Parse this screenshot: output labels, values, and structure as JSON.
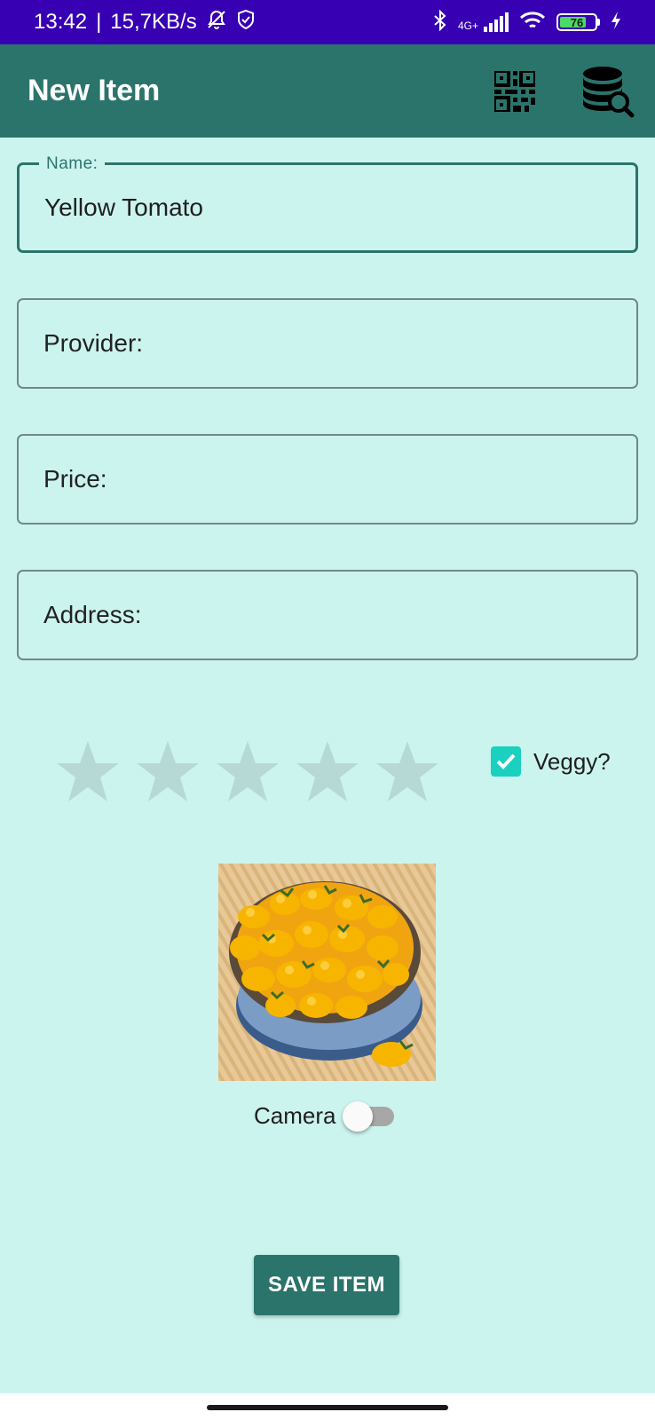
{
  "status_bar": {
    "time": "13:42",
    "separator": "|",
    "net_speed": "15,7KB/s",
    "network_type": "4G+",
    "battery_level": "76",
    "battery_fraction": 0.76,
    "icons": [
      "bell-off-icon",
      "shield-icon",
      "bluetooth-icon",
      "signal-icon",
      "wifi-icon",
      "battery-icon",
      "charging-icon"
    ]
  },
  "app_bar": {
    "title": "New Item",
    "background": "#2b746b",
    "actions": [
      "qr-code-icon",
      "database-search-icon"
    ]
  },
  "form": {
    "name": {
      "label": "Name:",
      "value": "Yellow Tomato"
    },
    "provider": {
      "placeholder": "Provider:"
    },
    "price": {
      "placeholder": "Price:"
    },
    "address": {
      "placeholder": "Address:"
    }
  },
  "rating": {
    "max": 5,
    "value": 0
  },
  "veggy": {
    "label": "Veggy?",
    "checked": true
  },
  "camera": {
    "label": "Camera",
    "enabled": false
  },
  "save": {
    "label": "SAVE ITEM"
  },
  "colors": {
    "accent": "#2b746b",
    "background": "#ccf4ef",
    "checkbox": "#1ad1c0",
    "status_bar": "#3700b3",
    "star_inactive": "#b7d9d5"
  }
}
